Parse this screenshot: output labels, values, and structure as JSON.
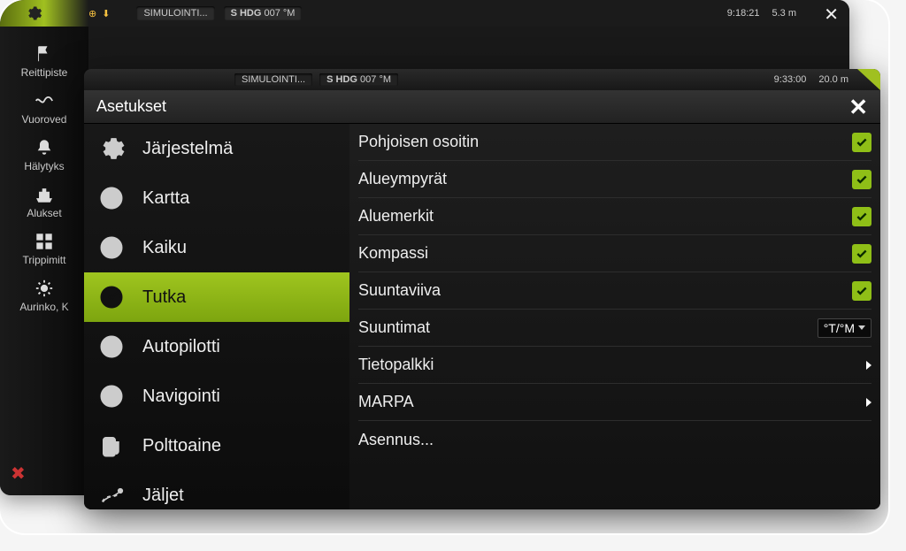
{
  "back": {
    "globe": "⊕",
    "sim": "SIMULOINTI...",
    "hdg_label": "S HDG",
    "hdg_value": "007 °M",
    "time": "9:18:21",
    "depth": "5.3 m",
    "sidebar": [
      {
        "label": "Reittipiste",
        "icon": "flag"
      },
      {
        "label": "Vuoroved",
        "icon": "wave"
      },
      {
        "label": "Hälytyks",
        "icon": "bell"
      },
      {
        "label": "Alukset",
        "icon": "ship"
      },
      {
        "label": "Trippimitt",
        "icon": "grid"
      },
      {
        "label": "Aurinko, K",
        "icon": "sun"
      }
    ]
  },
  "front": {
    "sim": "SIMULOINTI...",
    "hdg_label": "S HDG",
    "hdg_value": "007 °M",
    "time": "9:33:00",
    "depth": "20.0 m",
    "title": "Asetukset",
    "nav": [
      {
        "label": "Järjestelmä",
        "icon": "gear"
      },
      {
        "label": "Kartta",
        "icon": "globe"
      },
      {
        "label": "Kaiku",
        "icon": "sonar"
      },
      {
        "label": "Tutka",
        "icon": "radar",
        "selected": true
      },
      {
        "label": "Autopilotti",
        "icon": "wheel"
      },
      {
        "label": "Navigointi",
        "icon": "compass"
      },
      {
        "label": "Polttoaine",
        "icon": "fuel"
      },
      {
        "label": "Jäljet",
        "icon": "trail"
      }
    ],
    "rows": [
      {
        "label": "Pohjoisen osoitin",
        "type": "check",
        "checked": true
      },
      {
        "label": "Alueympyrät",
        "type": "check",
        "checked": true
      },
      {
        "label": "Aluemerkit",
        "type": "check",
        "checked": true
      },
      {
        "label": "Kompassi",
        "type": "check",
        "checked": true
      },
      {
        "label": "Suuntaviiva",
        "type": "check",
        "checked": true
      },
      {
        "label": "Suuntimat",
        "type": "select",
        "value": "°T/°M"
      },
      {
        "label": "Tietopalkki",
        "type": "arrow"
      },
      {
        "label": "MARPA",
        "type": "arrow"
      },
      {
        "label": "Asennus...",
        "type": "none"
      }
    ]
  }
}
